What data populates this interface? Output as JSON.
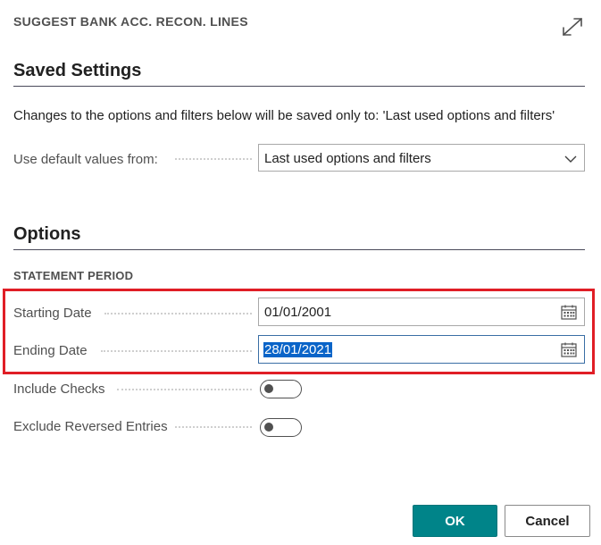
{
  "dialog": {
    "title": "SUGGEST BANK ACC. RECON. LINES",
    "expand_icon": "expand-diagonal-arrows-icon"
  },
  "saved_settings": {
    "title": "Saved Settings",
    "info": "Changes to the options and filters below will be saved only to: 'Last used options and filters'",
    "default_values_label": "Use default values from:",
    "default_values_selected": "Last used options and filters"
  },
  "options": {
    "title": "Options",
    "statement_period_heading": "STATEMENT PERIOD",
    "starting_date_label": "Starting Date",
    "starting_date_value": "01/01/2001",
    "ending_date_label": "Ending Date",
    "ending_date_value": "28/01/2021",
    "include_checks_label": "Include Checks",
    "include_checks_on": false,
    "exclude_reversed_label": "Exclude Reversed Entries",
    "exclude_reversed_on": false
  },
  "buttons": {
    "ok_label": "OK",
    "cancel_label": "Cancel"
  },
  "colors": {
    "primary_button": "#008489",
    "highlight_frame": "#e01e26",
    "text_selection": "#0a64c8"
  }
}
